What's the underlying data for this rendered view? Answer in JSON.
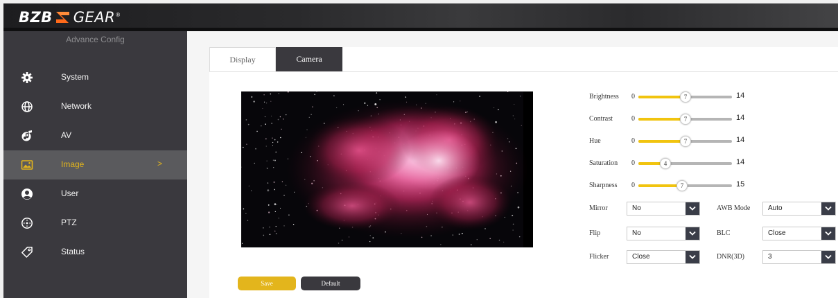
{
  "brand": {
    "left": "BZB",
    "right": "GEAR",
    "reg": "®",
    "accent": "#e3b51c",
    "mark_color": "#ff6a1a"
  },
  "sidebar": {
    "subtitle": "Advance Config",
    "items": [
      {
        "label": "System",
        "icon": "gear-icon"
      },
      {
        "label": "Network",
        "icon": "globe-icon"
      },
      {
        "label": "AV",
        "icon": "av-icon"
      },
      {
        "label": "Image",
        "icon": "image-icon",
        "active": true,
        "chevron": ">"
      },
      {
        "label": "User",
        "icon": "user-icon"
      },
      {
        "label": "PTZ",
        "icon": "ptz-icon"
      },
      {
        "label": "Status",
        "icon": "tag-icon"
      }
    ]
  },
  "tabs": [
    {
      "label": "Display",
      "active": false
    },
    {
      "label": "Camera",
      "active": true
    }
  ],
  "sliders": [
    {
      "label": "Brightness",
      "min": "0",
      "max": "14",
      "value": 7
    },
    {
      "label": "Contrast",
      "min": "0",
      "max": "14",
      "value": 7
    },
    {
      "label": "Hue",
      "min": "0",
      "max": "14",
      "value": 7
    },
    {
      "label": "Saturation",
      "min": "0",
      "max": "14",
      "value": 4
    },
    {
      "label": "Sharpness",
      "min": "0",
      "max": "15",
      "value": 7
    }
  ],
  "selects": [
    {
      "label": "Mirror",
      "value": "No"
    },
    {
      "label": "AWB Mode",
      "value": "Auto"
    },
    {
      "label": "Flip",
      "value": "No"
    },
    {
      "label": "BLC",
      "value": "Close"
    },
    {
      "label": "Flicker",
      "value": "Close"
    },
    {
      "label": "DNR(3D)",
      "value": "3"
    }
  ],
  "buttons": {
    "save": "Save",
    "default": "Default"
  }
}
